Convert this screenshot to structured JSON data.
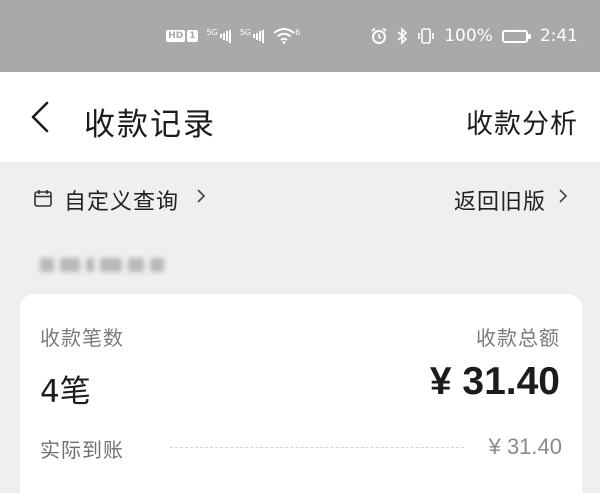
{
  "status_bar": {
    "hd_badge": "HD",
    "sim_badge": "1",
    "network1": "5G",
    "network2": "5G",
    "wifi_badge": "6",
    "battery_percent": "100%",
    "time": "2:41"
  },
  "header": {
    "title": "收款记录",
    "right_link": "收款分析"
  },
  "filter": {
    "custom_query": "自定义查询",
    "back_to_old": "返回旧版"
  },
  "summary": {
    "count_label": "收款笔数",
    "count_value": "4笔",
    "total_label": "收款总额",
    "total_value": "¥ 31.40",
    "received_label": "实际到账",
    "received_value": "¥ 31.40"
  },
  "icons": {
    "back": "chevron-left-icon",
    "calendar": "calendar-icon",
    "chevron": "chevron-right-icon",
    "alarm": "alarm-icon",
    "bluetooth": "bluetooth-icon",
    "vibrate": "vibrate-icon",
    "wifi": "wifi-icon",
    "battery": "battery-icon"
  }
}
